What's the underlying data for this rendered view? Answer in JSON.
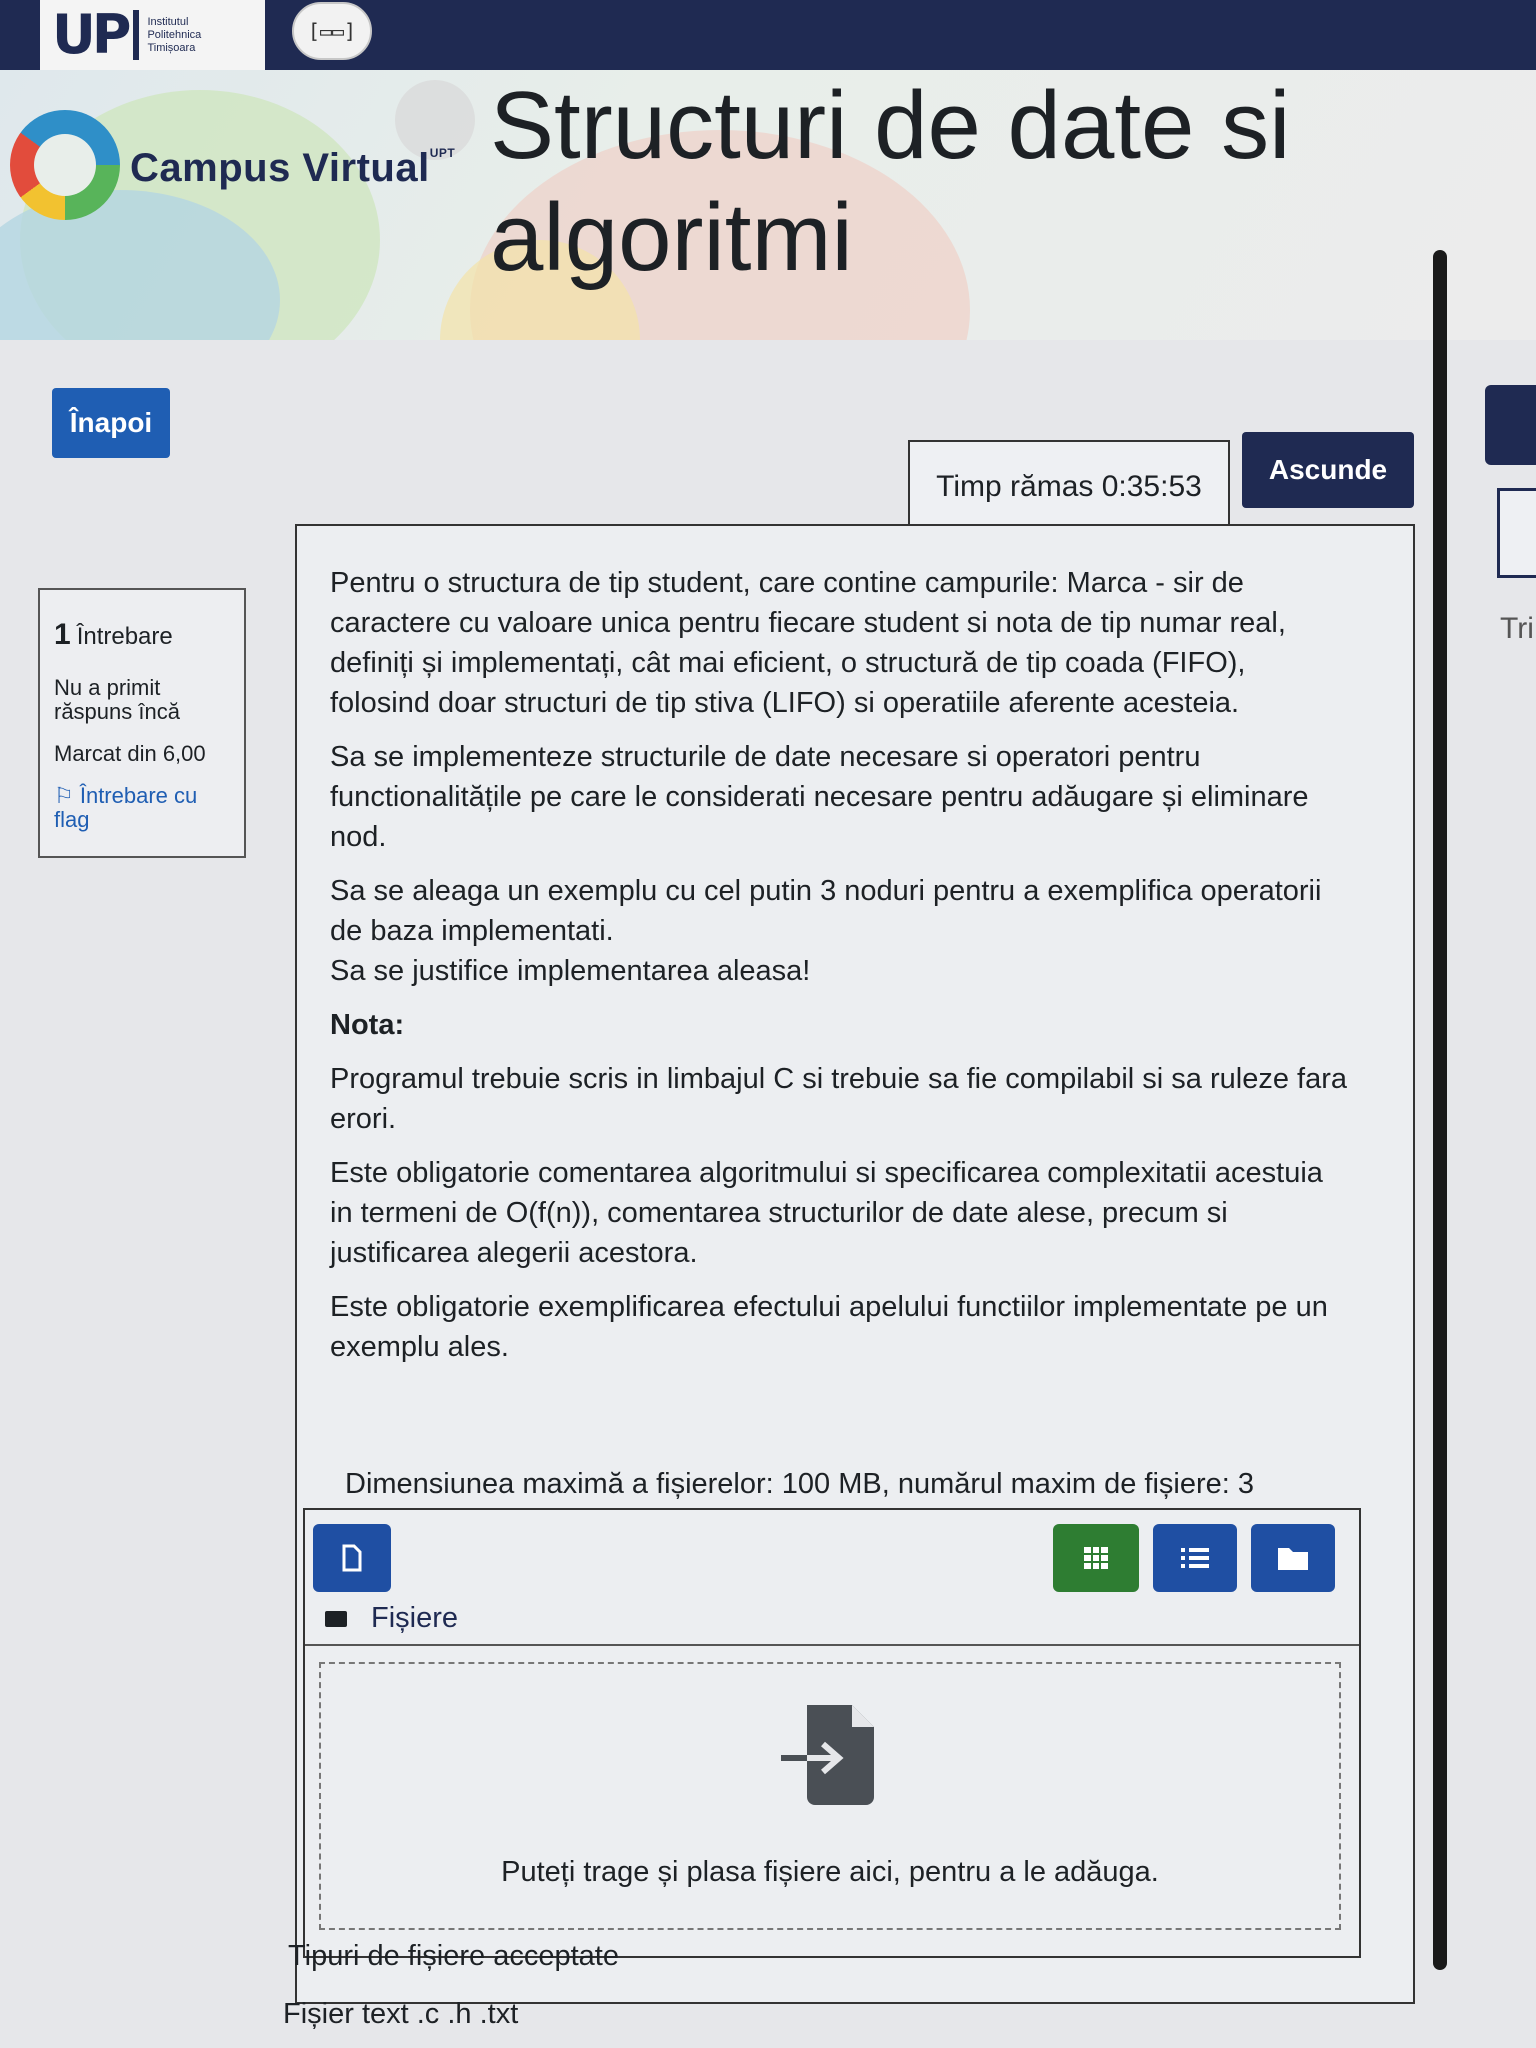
{
  "header": {
    "brand_small": [
      "Institutul",
      "Politehnica",
      "Timișoara"
    ],
    "brand_big": "UP",
    "campus_name": "Campus Virtual",
    "campus_sup": "UPT",
    "course_title": "Structuri de date si algoritmi"
  },
  "nav": {
    "back_label": "Înapoi",
    "timer_label": "Timp rămas 0:35:53",
    "hide_label": "Ascunde",
    "right_partial": "Tri"
  },
  "question_info": {
    "number": "1",
    "label": "Întrebare",
    "status": "Nu a primit răspuns încă",
    "mark": "Marcat din 6,00",
    "flag": "Întrebare cu flag"
  },
  "question": {
    "p1": "Pentru o structura de tip student, care contine campurile: Marca - sir de caractere cu valoare unica pentru fiecare student si nota de tip numar real, definiți și implementați, cât mai eficient, o structură de tip coada (FIFO), folosind doar structuri de tip stiva (LIFO) si operatiile aferente acesteia.",
    "p2": "Sa se implementeze structurile de date necesare si operatori pentru functionalitățile pe care le considerati necesare pentru adăugare și eliminare nod.",
    "p3a": "Sa se aleaga un exemplu cu cel putin 3 noduri pentru a exemplifica operatorii de baza implementati.",
    "p3b": "Sa se justifice implementarea aleasa!",
    "nota_label": "Nota:",
    "n1": "Programul trebuie scris in limbajul C si trebuie sa fie compilabil si sa ruleze fara erori.",
    "n2": "Este obligatorie comentarea algoritmului si specificarea complexitatii acestuia in termeni de O(f(n)), comentarea structurilor de date alese, precum si justificarea alegerii acestora.",
    "n3": "Este obligatorie exemplificarea efectului apelului functiilor implementate pe un exemplu ales."
  },
  "upload": {
    "limits": "Dimensiunea maximă a fișierelor: 100 MB, numărul maxim de fișiere: 3",
    "files_label": "Fișiere",
    "drop_text": "Puteți trage și plasa fișiere aici, pentru a le adăuga.",
    "accepted_label": "Tipuri de fișiere acceptate",
    "accepted_types": "Fișier text .c .h .txt",
    "icons": [
      "add-file-icon",
      "grid-view-icon",
      "list-view-icon",
      "folder-icon",
      "file-import-icon"
    ],
    "colors": {
      "primary": "#1f4fa3",
      "active": "#2e7d32",
      "navy": "#1f2a52"
    }
  }
}
